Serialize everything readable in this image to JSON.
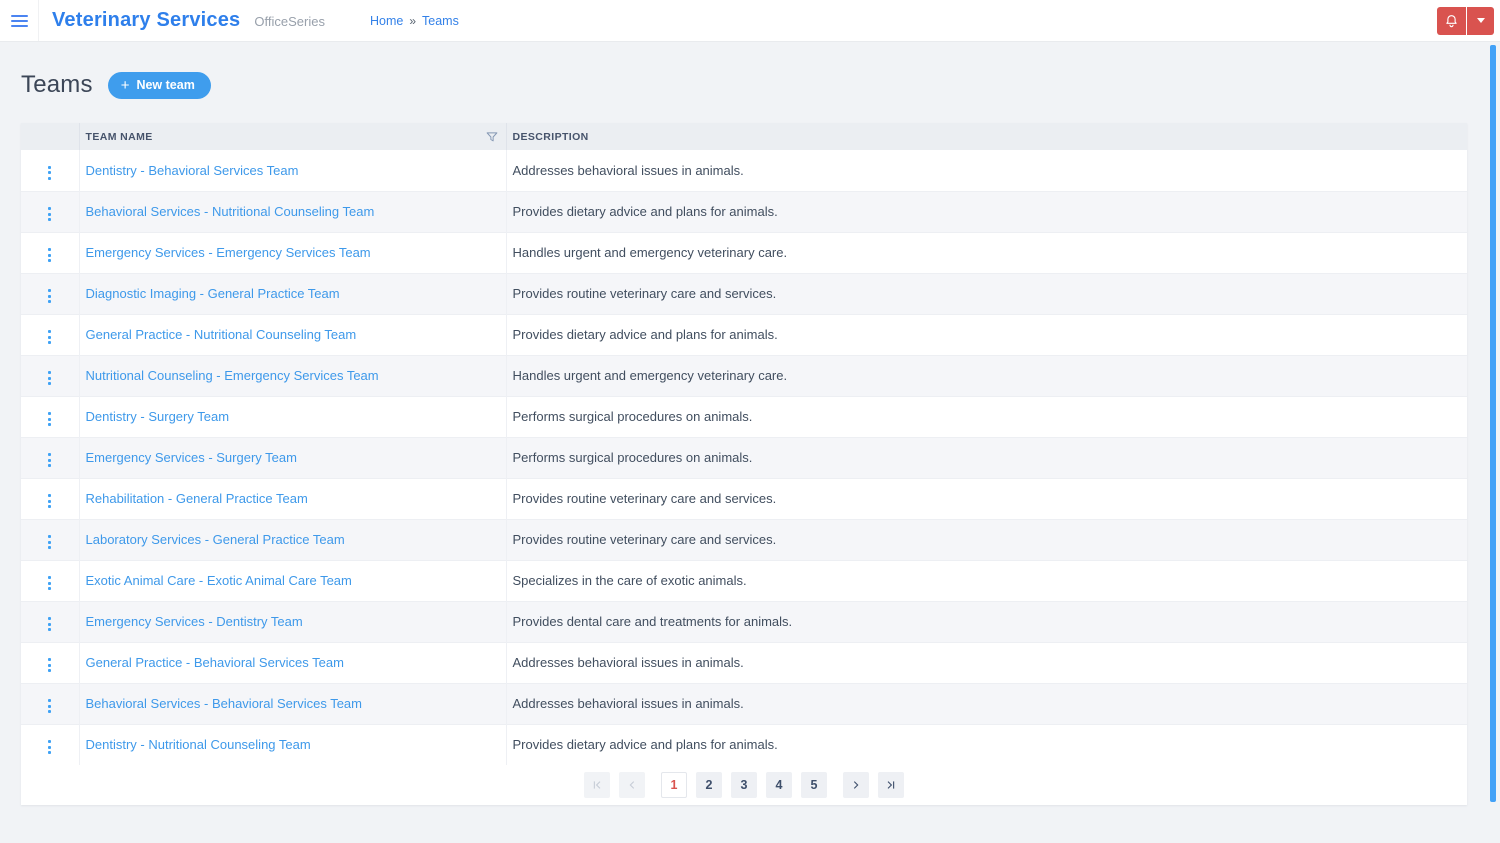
{
  "header": {
    "app_title": "Veterinary Services",
    "app_subtitle": "OfficeSeries",
    "breadcrumb": {
      "home": "Home",
      "separator": "»",
      "current": "Teams"
    }
  },
  "page": {
    "title": "Teams",
    "new_team_button": "New team",
    "plus_glyph": "+"
  },
  "table": {
    "columns": {
      "team_name": "TEAM NAME",
      "description": "DESCRIPTION"
    },
    "rows": [
      {
        "name": "Dentistry - Behavioral Services Team",
        "description": "Addresses behavioral issues in animals."
      },
      {
        "name": "Behavioral Services - Nutritional Counseling Team",
        "description": "Provides dietary advice and plans for animals."
      },
      {
        "name": "Emergency Services - Emergency Services Team",
        "description": "Handles urgent and emergency veterinary care."
      },
      {
        "name": "Diagnostic Imaging - General Practice Team",
        "description": "Provides routine veterinary care and services."
      },
      {
        "name": "General Practice - Nutritional Counseling Team",
        "description": "Provides dietary advice and plans for animals."
      },
      {
        "name": "Nutritional Counseling - Emergency Services Team",
        "description": "Handles urgent and emergency veterinary care."
      },
      {
        "name": "Dentistry - Surgery Team",
        "description": "Performs surgical procedures on animals."
      },
      {
        "name": "Emergency Services - Surgery Team",
        "description": "Performs surgical procedures on animals."
      },
      {
        "name": "Rehabilitation - General Practice Team",
        "description": "Provides routine veterinary care and services."
      },
      {
        "name": "Laboratory Services - General Practice Team",
        "description": "Provides routine veterinary care and services."
      },
      {
        "name": "Exotic Animal Care - Exotic Animal Care Team",
        "description": "Specializes in the care of exotic animals."
      },
      {
        "name": "Emergency Services - Dentistry Team",
        "description": "Provides dental care and treatments for animals."
      },
      {
        "name": "General Practice - Behavioral Services Team",
        "description": "Addresses behavioral issues in animals."
      },
      {
        "name": "Behavioral Services - Behavioral Services Team",
        "description": "Addresses behavioral issues in animals."
      },
      {
        "name": "Dentistry - Nutritional Counseling Team",
        "description": "Provides dietary advice and plans for animals."
      }
    ]
  },
  "pagination": {
    "items": [
      {
        "type": "first",
        "state": "disabled"
      },
      {
        "type": "prev",
        "state": "disabled"
      },
      {
        "type": "page",
        "label": "1",
        "state": "active"
      },
      {
        "type": "page",
        "label": "2",
        "state": "normal"
      },
      {
        "type": "page",
        "label": "3",
        "state": "normal"
      },
      {
        "type": "page",
        "label": "4",
        "state": "normal"
      },
      {
        "type": "page",
        "label": "5",
        "state": "normal"
      },
      {
        "type": "next",
        "state": "normal"
      },
      {
        "type": "last",
        "state": "normal"
      }
    ]
  },
  "icons": {
    "hamburger-icon": "≡",
    "bell-icon": "bell outline",
    "caret-down-icon": "▾",
    "filter-icon": "funnel outline",
    "kebab-icon": "⋮",
    "pagination-first": "|<",
    "pagination-prev": "<",
    "pagination-next": ">",
    "pagination-last": ">|"
  },
  "colors": {
    "brand_blue": "#2e7feb",
    "accent_blue": "#3f9ded",
    "link_blue": "#3e99ea",
    "danger_red": "#d9534f",
    "scrollbar_blue": "#42a1f7",
    "table_header_bg": "#ebeef2",
    "row_alt_bg": "#f5f6f9",
    "page_bg": "#f1f3f6"
  }
}
